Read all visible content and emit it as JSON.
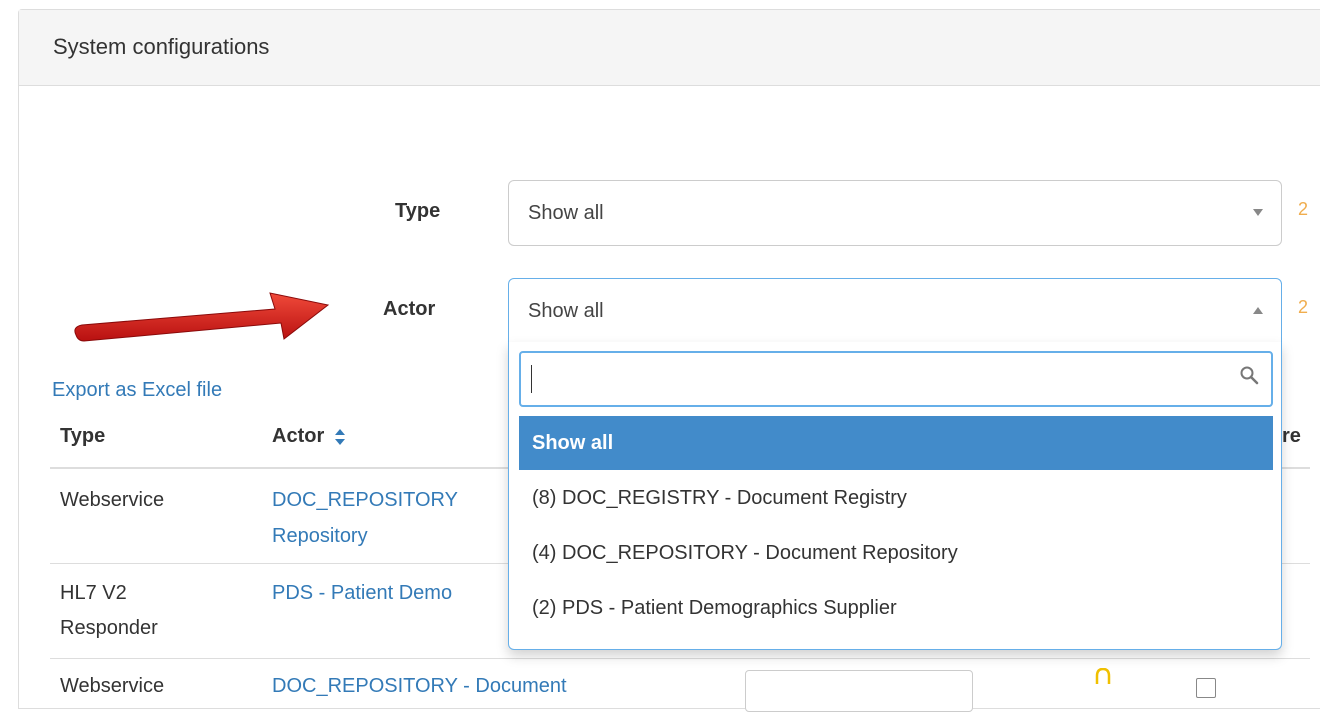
{
  "panel": {
    "title": "System configurations"
  },
  "filters": {
    "type": {
      "label": "Type",
      "value": "Show all"
    },
    "actor": {
      "label": "Actor",
      "value": "Show all"
    },
    "side_mark": "2"
  },
  "export_link": "Export as Excel file",
  "table": {
    "headers": {
      "type": "Type",
      "actor": "Actor",
      "partial": "re"
    },
    "rows": [
      {
        "type": "Webservice",
        "actor_line1": "DOC_REPOSITORY",
        "actor_line2": "Repository"
      },
      {
        "type_line1": "HL7 V2",
        "type_line2": "Responder",
        "actor": "PDS - Patient Demo"
      },
      {
        "type": "Webservice",
        "actor": "DOC_REPOSITORY - Document"
      }
    ]
  },
  "actor_dropdown": {
    "search_placeholder": "",
    "options": [
      {
        "label": "Show all",
        "selected": true
      },
      {
        "label": "(8) DOC_REGISTRY - Document Registry"
      },
      {
        "label": "(4) DOC_REPOSITORY - Document Repository"
      },
      {
        "label": "(2) PDS - Patient Demographics Supplier"
      }
    ]
  },
  "colors": {
    "accent": "#428bca",
    "link": "#337ab7",
    "focus_border": "#66afe9",
    "annotation_arrow": "#e02020"
  },
  "icons": {
    "search": "search-icon",
    "sort": "sort-icon",
    "arrow": "annotation-arrow"
  }
}
